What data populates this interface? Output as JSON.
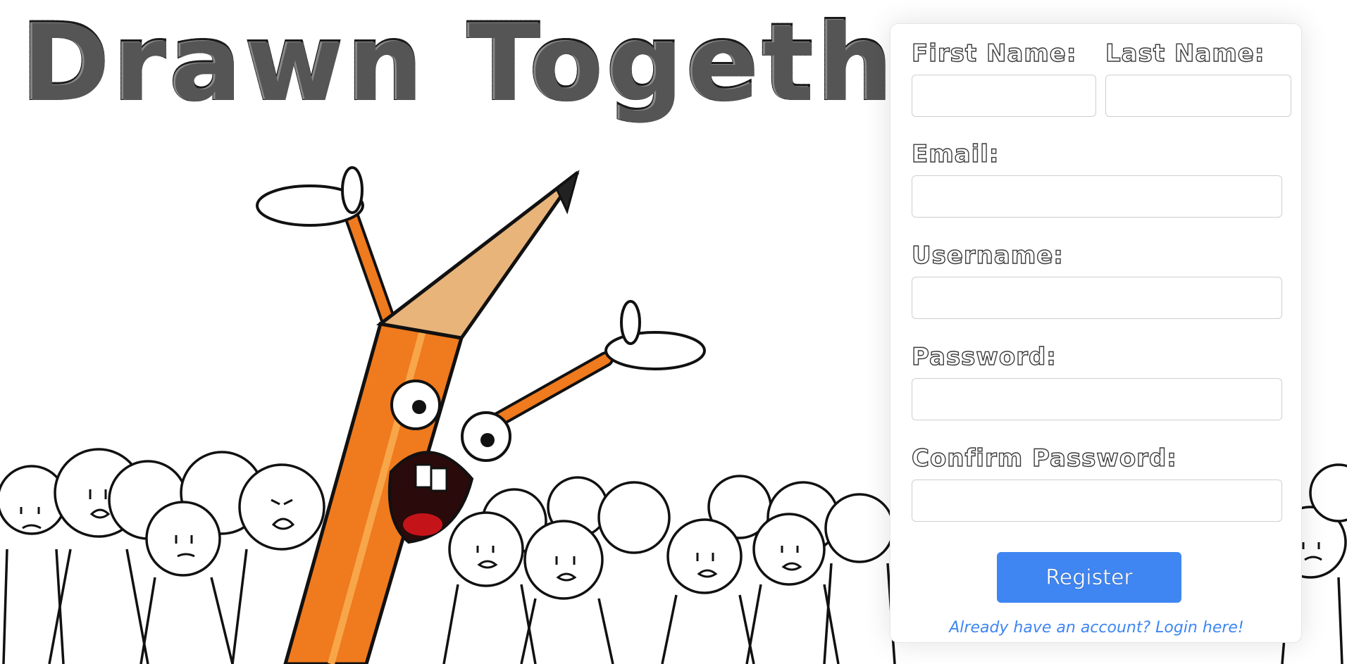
{
  "app": {
    "title": "Drawn Together"
  },
  "form": {
    "first_name_label": "First Name:",
    "last_name_label": "Last Name:",
    "email_label": "Email:",
    "username_label": "Username:",
    "password_label": "Password:",
    "confirm_password_label": "Confirm Password:",
    "first_name_value": "",
    "last_name_value": "",
    "email_value": "",
    "username_value": "",
    "password_value": "",
    "confirm_password_value": "",
    "register_label": "Register",
    "login_link_text": "Already have an account? Login here!"
  },
  "colors": {
    "accent": "#3f86f2",
    "pencil_body": "#f07a1e",
    "pencil_wood": "#e8b47a",
    "outline": "#1a1a1a"
  }
}
